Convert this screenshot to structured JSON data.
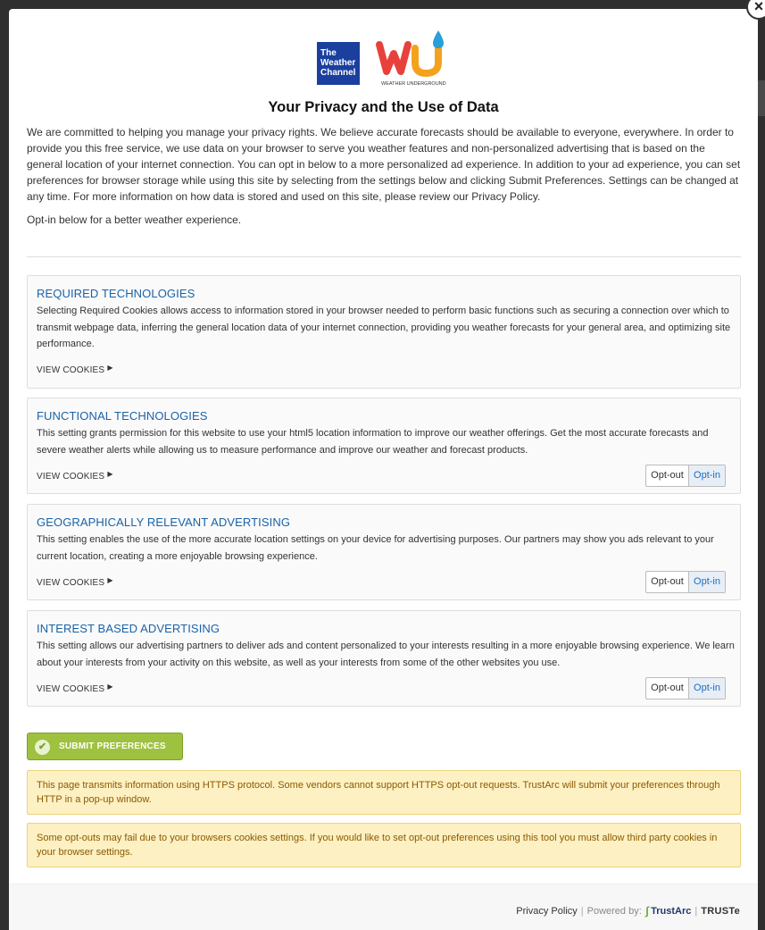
{
  "close_icon": "close-icon",
  "logos": {
    "twc_text": "The Weather Channel",
    "wu_caption": "WEATHER UNDERGROUND",
    "wu_colors": [
      "#e8413c",
      "#f4a21e",
      "#2a9fd8"
    ]
  },
  "title": "Your Privacy and the Use of Data",
  "intro": "We are committed to helping you manage your privacy rights. We believe accurate forecasts should be available to everyone, everywhere. In order to provide you this free service, we use data on your browser to serve you weather features and non-personalized advertising that is based on the general location of your internet connection. You can opt in below to a more personalized ad experience. In addition to your ad experience, you can set preferences for browser storage while using this site by selecting from the settings below and clicking Submit Preferences. Settings can be changed at any time. For more information on how data is stored and used on this site, please review our Privacy Policy.",
  "optin_note": "Opt-in below for a better weather experience.",
  "sections": [
    {
      "title": "REQUIRED TECHNOLOGIES",
      "text": "Selecting Required Cookies allows access to information stored in your browser needed to perform basic functions such as securing a connection over which to transmit webpage data, inferring the general location data of your internet connection, providing you weather forecasts for your general area, and optimizing site performance.",
      "view_cookies": "VIEW COOKIES"
    },
    {
      "title": "FUNCTIONAL TECHNOLOGIES",
      "text": "This setting grants permission for this website to use your html5 location information to improve our weather offerings. Get the most accurate forecasts and severe weather alerts while allowing us to measure performance and improve our weather and forecast products.",
      "view_cookies": "VIEW COOKIES",
      "opt_out": "Opt-out",
      "opt_in": "Opt-in"
    },
    {
      "title": "GEOGRAPHICALLY RELEVANT ADVERTISING",
      "text": "This setting enables the use of the more accurate location settings on your device for advertising purposes. Our partners may show you ads relevant to your current location, creating a more enjoyable browsing experience.",
      "view_cookies": "VIEW COOKIES",
      "opt_out": "Opt-out",
      "opt_in": "Opt-in"
    },
    {
      "title": "INTEREST BASED ADVERTISING",
      "text": "This setting allows our advertising partners to deliver ads and content personalized to your interests resulting in a more enjoyable browsing experience. We learn about your interests from your activity on this website, as well as your interests from some of the other websites you use.",
      "view_cookies": "VIEW COOKIES",
      "opt_out": "Opt-out",
      "opt_in": "Opt-in"
    }
  ],
  "submit_label": "SUBMIT PREFERENCES",
  "notices": [
    "This page transmits information using HTTPS protocol. Some vendors cannot support HTTPS opt-out requests. TrustArc will submit your preferences through HTTP in a pop-up window.",
    "Some opt-outs may fail due to your browsers cookies settings. If you would like to set opt-out preferences using this tool you must allow third party cookies in your browser settings."
  ],
  "footer": {
    "privacy_policy": "Privacy Policy",
    "separator": "|",
    "powered_by": "Powered by:",
    "trustarc": "TrustArc",
    "separator2": "|",
    "truste": "TRUSTe"
  }
}
